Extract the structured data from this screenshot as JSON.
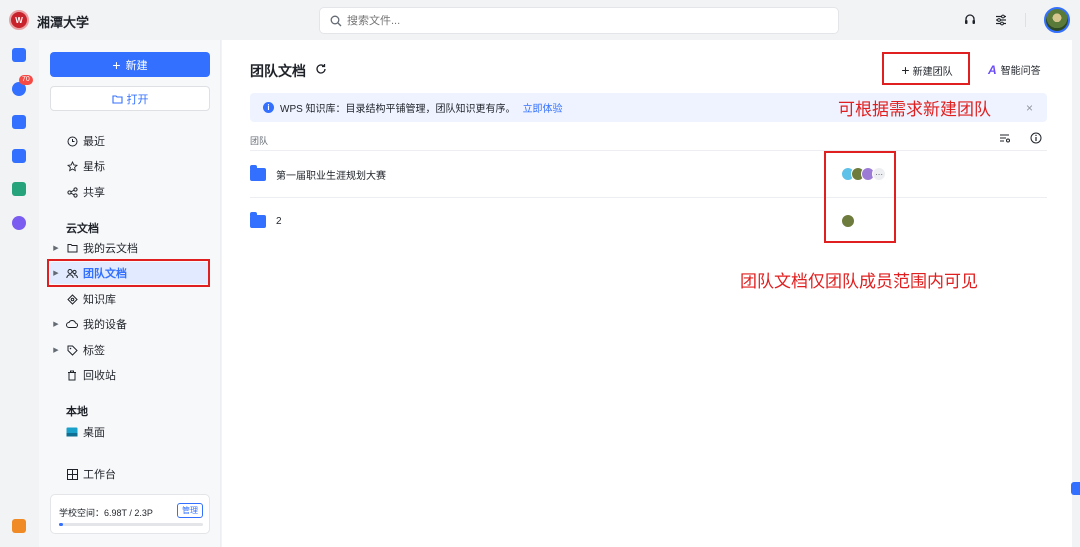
{
  "app": {
    "title": "湘潭大学",
    "logo_text": "W"
  },
  "search": {
    "placeholder": "搜索文件..."
  },
  "rail": {
    "badge_count": "70"
  },
  "sidebar": {
    "new_label": "新建",
    "open_label": "打开",
    "items_top": [
      {
        "label": "最近",
        "icon": "clock-icon"
      },
      {
        "label": "星标",
        "icon": "star-icon"
      },
      {
        "label": "共享",
        "icon": "share-icon"
      }
    ],
    "cloud_section": "云文档",
    "items_cloud": [
      {
        "label": "我的云文档",
        "icon": "folder-icon"
      },
      {
        "label": "团队文档",
        "icon": "team-icon"
      },
      {
        "label": "知识库",
        "icon": "knowledge-icon"
      },
      {
        "label": "我的设备",
        "icon": "device-icon"
      },
      {
        "label": "标签",
        "icon": "tag-icon"
      },
      {
        "label": "回收站",
        "icon": "trash-icon"
      }
    ],
    "local_section": "本地",
    "desktop_label": "桌面",
    "workbench_label": "工作台",
    "storage": {
      "text": "学校空间：6.98T / 2.3P",
      "manage_label": "管理",
      "used_fraction": 0.03
    }
  },
  "main": {
    "title": "团队文档",
    "new_team_label": "新建团队",
    "ai_label": "智能问答",
    "notice": {
      "text": "WPS 知识库：目录结构平铺管理，团队知识更有序。",
      "link": "立即体验",
      "close": "×"
    },
    "column_header": "团队",
    "rows": [
      {
        "name": "第一届职业生涯规划大赛"
      },
      {
        "name": "2"
      }
    ]
  },
  "annotations": {
    "new_team_note": "可根据需求新建团队",
    "visibility_note": "团队文档仅团队成员范围内可见"
  },
  "colors": {
    "accent": "#3370ff",
    "annotation": "#e02020",
    "brand": "#c8232c"
  }
}
